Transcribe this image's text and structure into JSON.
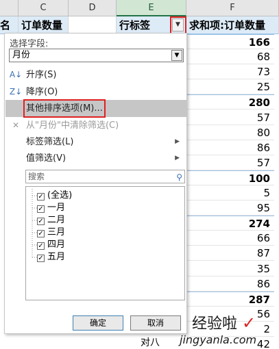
{
  "columns": {
    "c": "C",
    "d": "D",
    "e": "E",
    "f": "F"
  },
  "header_cells": {
    "b_frag": "名",
    "c": "订单数量",
    "e": "行标签",
    "f": "求和项:订单数量"
  },
  "left_fragments": [
    "名",
    "份",
    "",
    "",
    "",
    "",
    "",
    "",
    "",
    "",
    "",
    "",
    "",
    "",
    "",
    "",
    "",
    "",
    "",
    "",
    "",
    "",
    "",
    "",
    "",
    "",
    ""
  ],
  "values": [
    {
      "v": "166",
      "bold": true
    },
    {
      "v": "68",
      "bold": false
    },
    {
      "v": "73",
      "bold": false
    },
    {
      "v": "25",
      "bold": false
    },
    {
      "v": "280",
      "bold": true
    },
    {
      "v": "57",
      "bold": false
    },
    {
      "v": "80",
      "bold": false
    },
    {
      "v": "86",
      "bold": false
    },
    {
      "v": "57",
      "bold": false
    },
    {
      "v": "100",
      "bold": true
    },
    {
      "v": "5",
      "bold": false
    },
    {
      "v": "95",
      "bold": false
    },
    {
      "v": "274",
      "bold": true
    },
    {
      "v": "66",
      "bold": false
    },
    {
      "v": "87",
      "bold": false
    },
    {
      "v": "35",
      "bold": false
    },
    {
      "v": "86",
      "bold": false
    },
    {
      "v": "287",
      "bold": true
    },
    {
      "v": "56",
      "bold": false
    },
    {
      "v": "2",
      "bold": false
    },
    {
      "v": "42",
      "bold": false
    }
  ],
  "below_menu_text": "对八",
  "menu": {
    "field_label": "选择字段:",
    "field_value": "月份",
    "items": [
      {
        "label": "升序(S)",
        "icon": "sort-ascending-icon",
        "glyph": "A↓",
        "state": "normal"
      },
      {
        "label": "降序(O)",
        "icon": "sort-descending-icon",
        "glyph": "Z↓",
        "state": "normal"
      },
      {
        "label": "其他排序选项(M)...",
        "icon": "",
        "glyph": "",
        "state": "highlighted"
      },
      {
        "label": "从\"月份\"中清除筛选(C)",
        "icon": "clear-filter-icon",
        "glyph": "✕",
        "state": "disabled"
      },
      {
        "label": "标签筛选(L)",
        "icon": "",
        "glyph": "",
        "state": "submenu"
      },
      {
        "label": "值筛选(V)",
        "icon": "",
        "glyph": "",
        "state": "submenu"
      }
    ],
    "search_placeholder": "搜索",
    "list": [
      {
        "label": "(全选)",
        "checked": true
      },
      {
        "label": "一月",
        "checked": true
      },
      {
        "label": "二月",
        "checked": true
      },
      {
        "label": "三月",
        "checked": true
      },
      {
        "label": "四月",
        "checked": true
      },
      {
        "label": "五月",
        "checked": true
      }
    ],
    "ok_label": "确定",
    "cancel_label": "取消"
  },
  "watermark": {
    "text": "经验啦",
    "check": "✓",
    "url": "jingyanla.com"
  },
  "colors": {
    "highlight_box": "#e02020",
    "header_fill": "#ddebf7",
    "menu_highlight": "#c6c6c6"
  }
}
